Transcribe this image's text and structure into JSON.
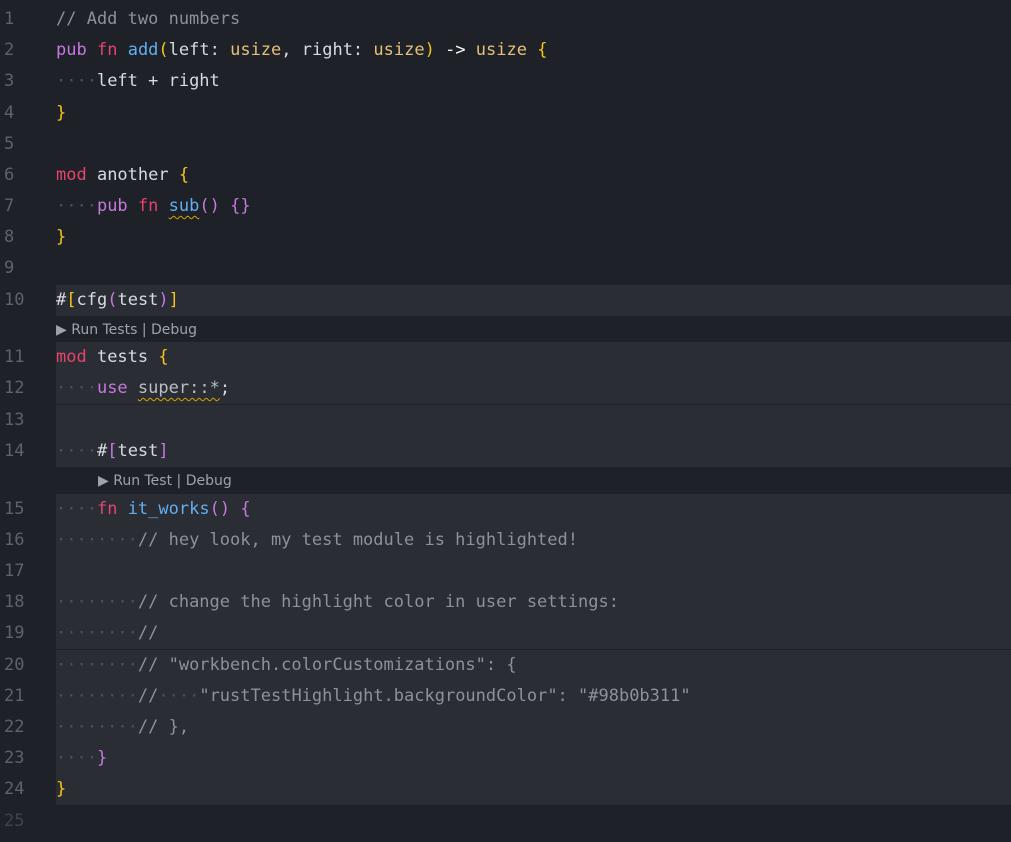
{
  "gutter": {
    "line_numbers": [
      "1",
      "2",
      "3",
      "4",
      "5",
      "6",
      "7",
      "8",
      "9",
      "10",
      "11",
      "12",
      "13",
      "14",
      "15",
      "16",
      "17",
      "18",
      "19",
      "20",
      "21",
      "22",
      "23",
      "24",
      "25"
    ]
  },
  "code": {
    "l1_comment": "// Add two numbers",
    "l2_pub": "pub",
    "l2_fn": "fn",
    "l2_name": "add",
    "l2_open": "(",
    "l2_left": "left: ",
    "l2_usize1": "usize",
    "l2_right": ", right: ",
    "l2_usize2": "usize",
    "l2_close": ")",
    "l2_arrow": " -> ",
    "l2_ret": "usize",
    "l2_brace": "{",
    "l3_indent": "····",
    "l3_expr": "left + right",
    "l4_brace": "}",
    "l6_mod": "mod",
    "l6_name": " another ",
    "l6_brace": "{",
    "l7_indent": "····",
    "l7_pub": "pub",
    "l7_fn": "fn",
    "l7_name": "sub",
    "l7_parens": "()",
    "l7_body": "{}",
    "l8_brace": "}",
    "l10_hash": "#",
    "l10_open": "[",
    "l10_cfg": "cfg",
    "l10_popen": "(",
    "l10_test": "test",
    "l10_pclose": ")",
    "l10_close": "]",
    "l11_mod": "mod",
    "l11_name": " tests ",
    "l11_brace": "{",
    "l12_indent": "····",
    "l12_use": "use",
    "l12_path": "super::*",
    "l12_semi": ";",
    "l14_indent": "····",
    "l14_hash": "#",
    "l14_open": "[",
    "l14_test": "test",
    "l14_close": "]",
    "l15_indent": "····",
    "l15_fn": "fn",
    "l15_name": "it_works",
    "l15_parens": "()",
    "l15_brace": "{",
    "l16_indent": "········",
    "l16_comment": "// hey look, my test module is highlighted!",
    "l18_indent": "········",
    "l18_comment": "// change the highlight color in user settings:",
    "l19_indent": "········",
    "l19_comment": "//",
    "l20_indent": "········",
    "l20_comment": "// \"workbench.colorCustomizations\": {",
    "l21_indent": "········",
    "l21_comment_a": "//",
    "l21_dots": "····",
    "l21_comment_b": "\"rustTestHighlight.backgroundColor\": \"#98b0b311\"",
    "l22_indent": "········",
    "l22_comment": "// },",
    "l23_indent": "····",
    "l23_brace": "}",
    "l24_brace": "}"
  },
  "codelens": {
    "module": {
      "run": "▶ Run Tests",
      "sep": " | ",
      "debug": "Debug"
    },
    "fn": {
      "run": "▶ Run Test",
      "sep": " | ",
      "debug": "Debug"
    }
  },
  "colors": {
    "background": "#1e2127",
    "test_highlight": "#2a2d33",
    "keyword": "#c678dd",
    "keyword_mod": "#e5446d",
    "function": "#61afef",
    "type": "#e5c07b",
    "bracket": "#f5c518",
    "comment": "#8c919a"
  }
}
